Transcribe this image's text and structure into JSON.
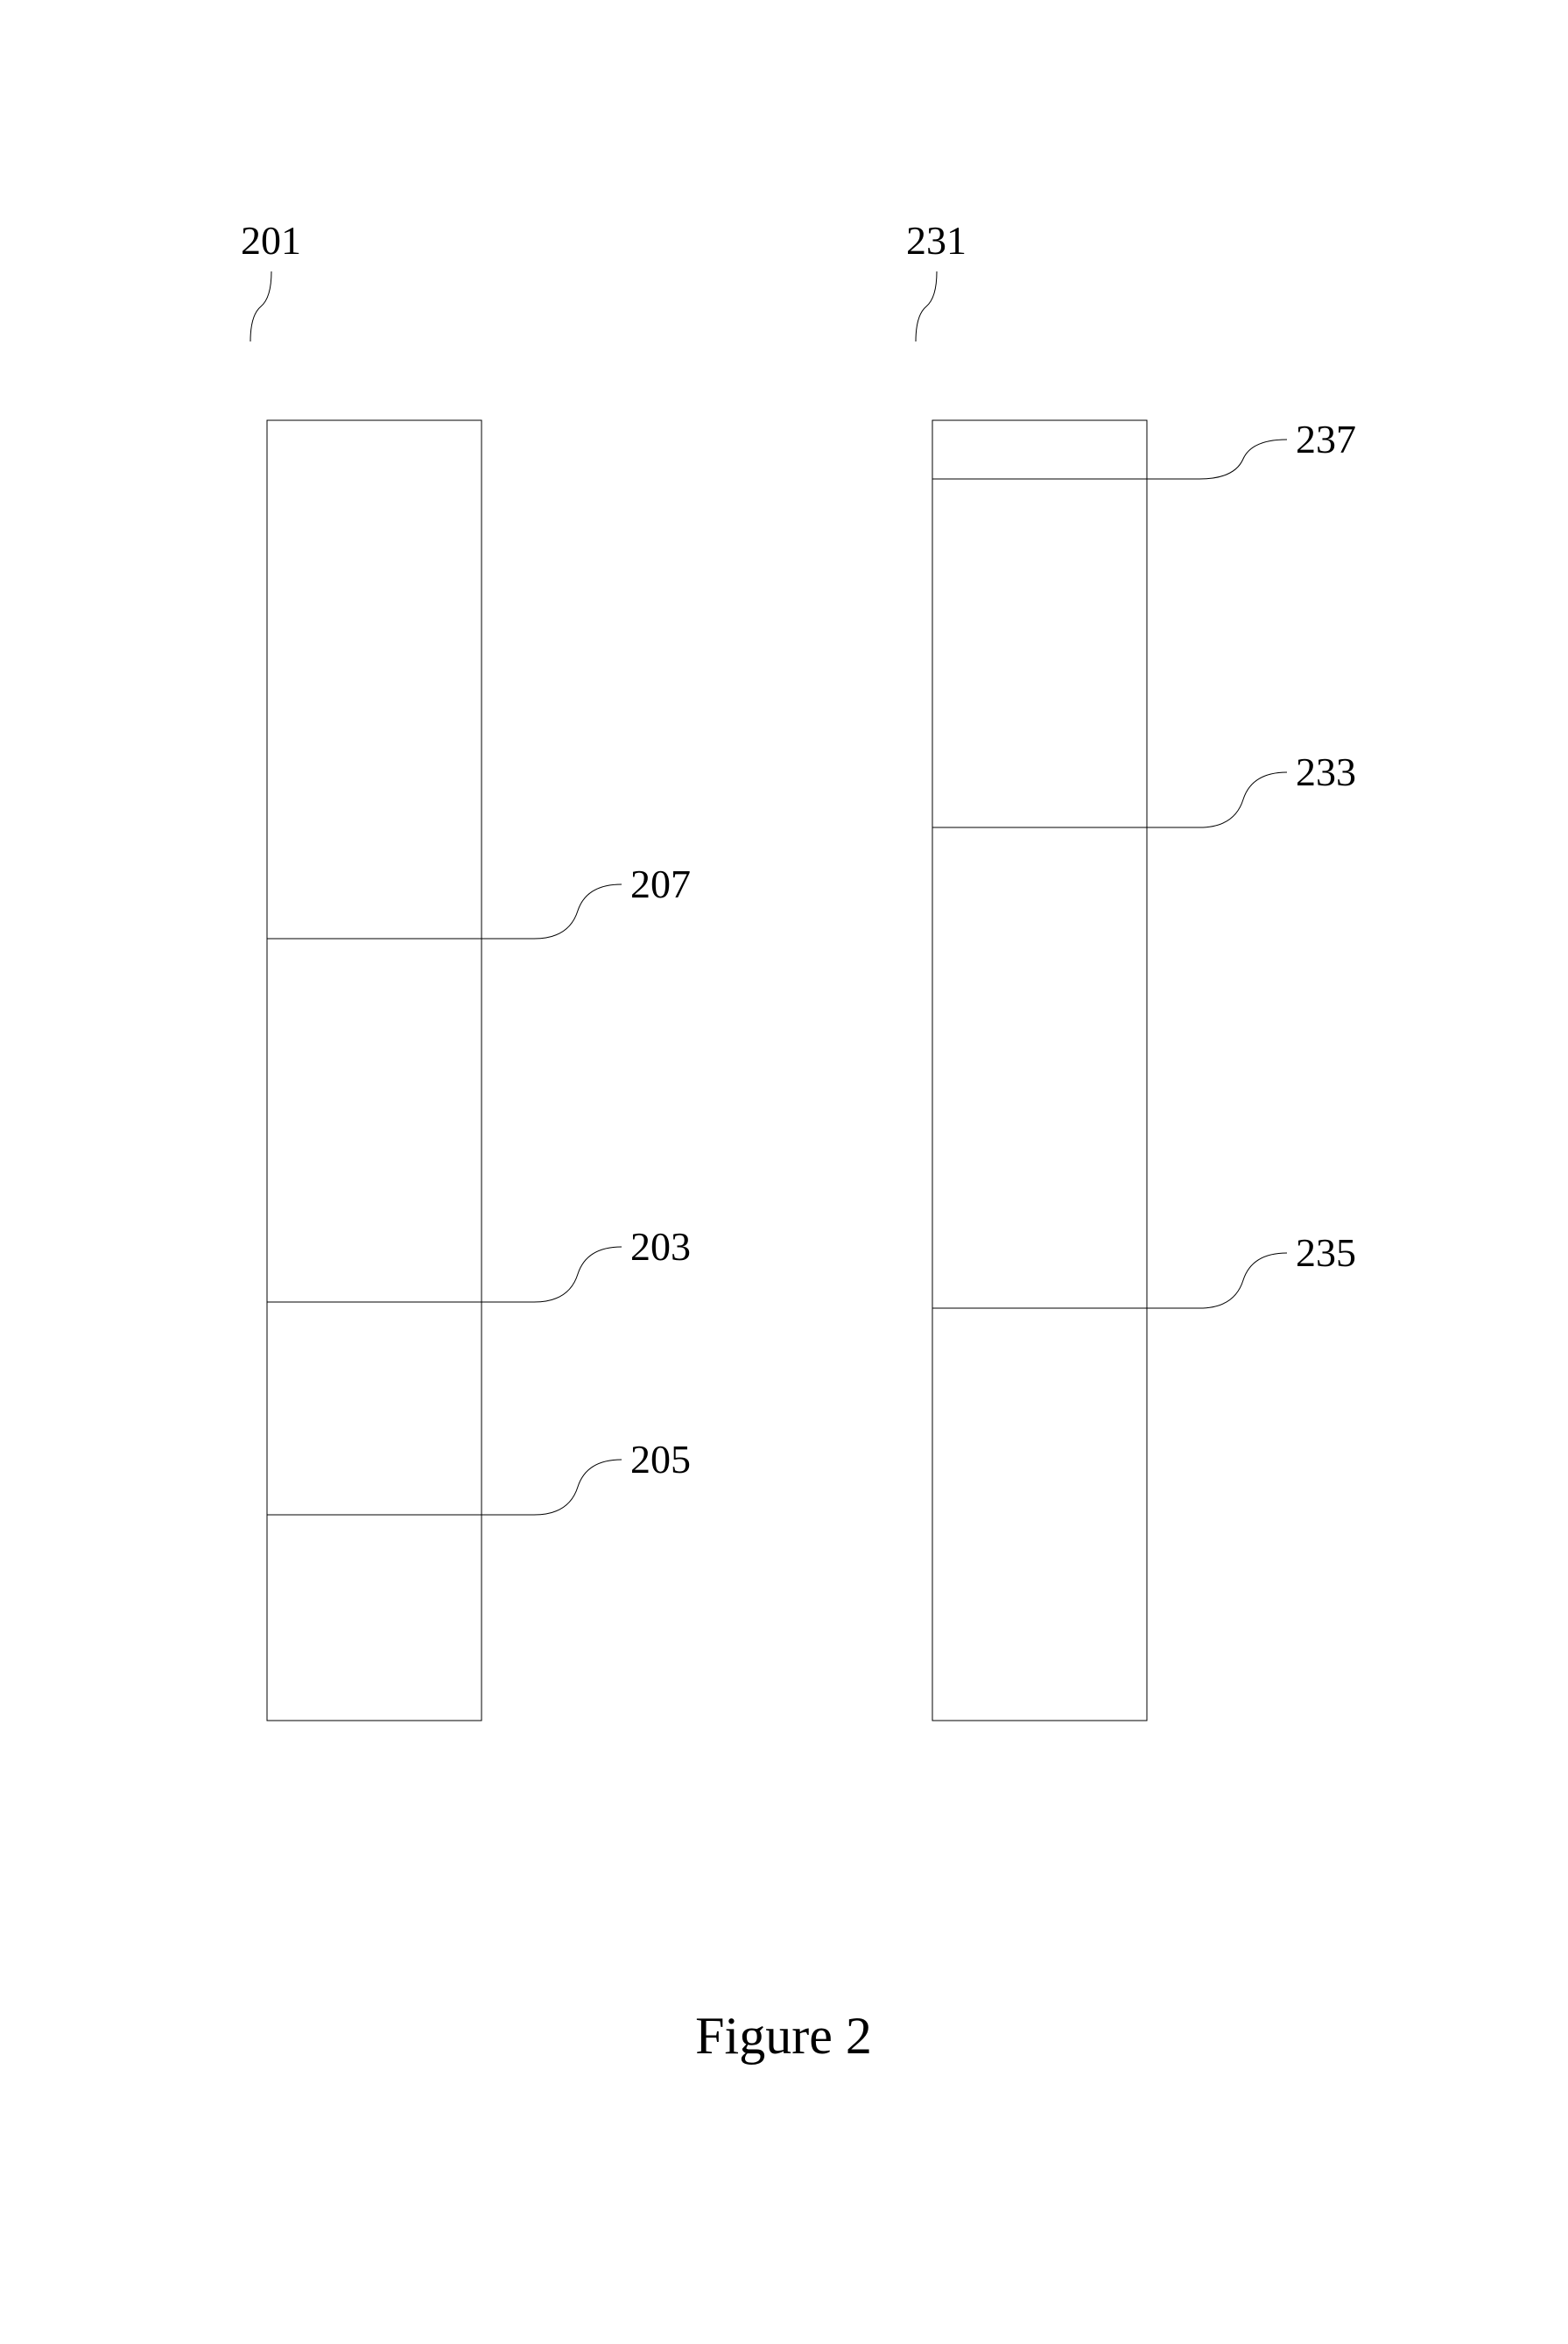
{
  "figure_label": "Figure 2",
  "left": {
    "id": "201",
    "annotations": [
      {
        "id": "207"
      },
      {
        "id": "203"
      },
      {
        "id": "205"
      }
    ]
  },
  "right": {
    "id": "231",
    "annotations": [
      {
        "id": "237"
      },
      {
        "id": "233"
      },
      {
        "id": "235"
      }
    ]
  }
}
